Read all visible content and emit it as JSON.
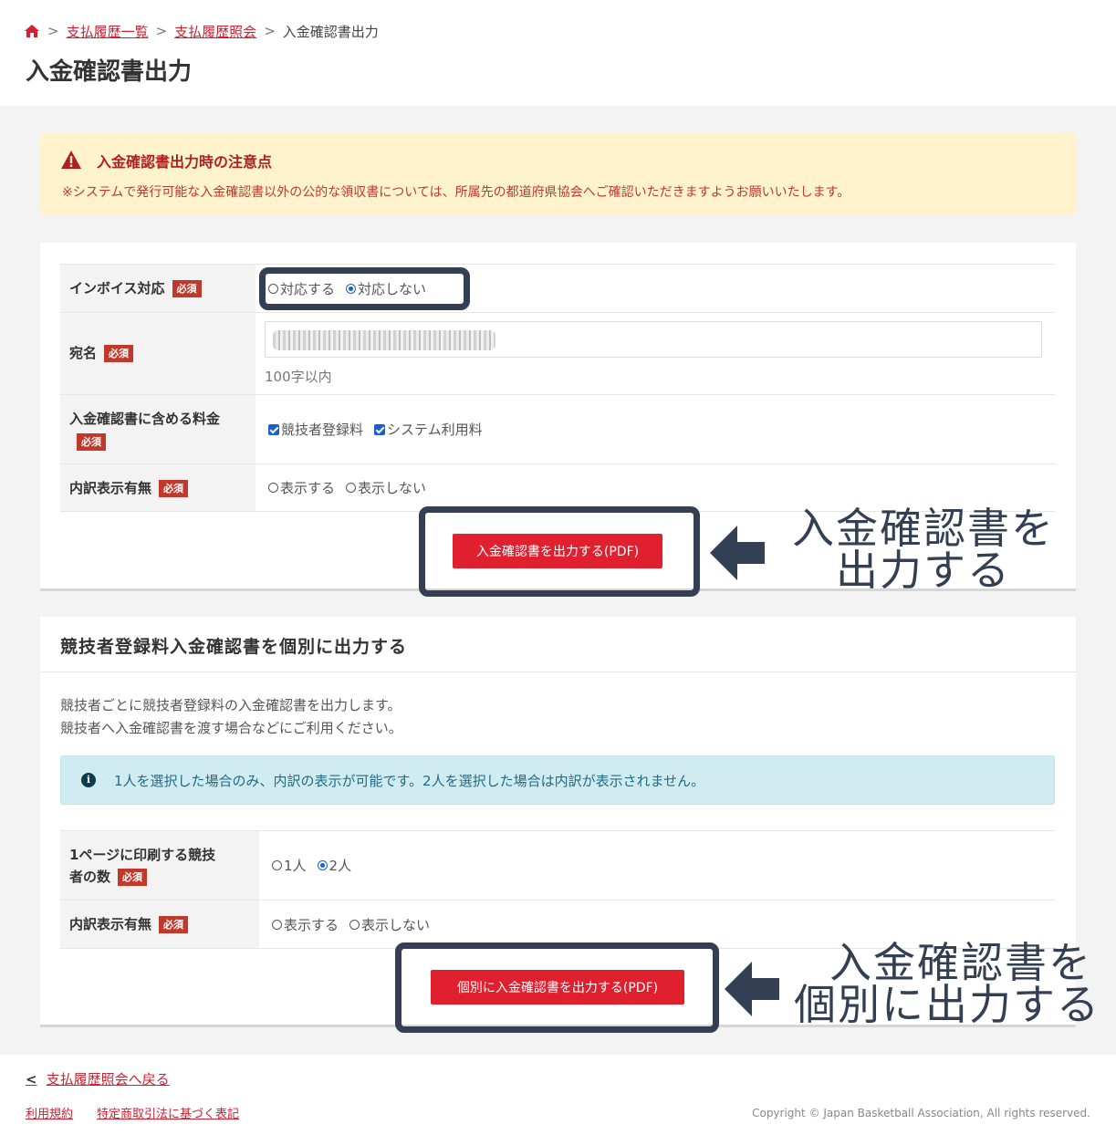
{
  "breadcrumb": {
    "home_icon": "home-icon",
    "items": [
      "支払履歴一覧",
      "支払履歴照会"
    ],
    "current": "入金確認書出力",
    "separator": ">"
  },
  "page_title": "入金確認書出力",
  "alert": {
    "icon": "warning-icon",
    "title": "入金確認書出力時の注意点",
    "text": "※システムで発行可能な入金確認書以外の公的な領収書については、所属先の都道府県協会へご確認いただきますようお願いいたします。"
  },
  "required_badge": "必須",
  "form1": {
    "invoice": {
      "label": "インボイス対応",
      "options": [
        "対応する",
        "対応しない"
      ],
      "selected": "対応しない"
    },
    "addressee": {
      "label": "宛名",
      "value": "",
      "hint": "100字以内"
    },
    "fees": {
      "label": "入金確認書に含める料金",
      "options": [
        "競技者登録料",
        "システム利用料"
      ],
      "checked": [
        "競技者登録料",
        "システム利用料"
      ]
    },
    "breakdown": {
      "label": "内訳表示有無",
      "options": [
        "表示する",
        "表示しない"
      ]
    },
    "submit_label": "入金確認書を出力する(PDF)"
  },
  "annotation1": [
    "入金確認書を",
    "出力する"
  ],
  "section2": {
    "title": "競技者登録料入金確認書を個別に出力する",
    "desc": [
      "競技者ごとに競技者登録料の入金確認書を出力します。",
      "競技者へ入金確認書を渡す場合などにご利用ください。"
    ],
    "info_icon": "info-icon",
    "info": "1人を選択した場合のみ、内訳の表示が可能です。2人を選択した場合は内訳が表示されません。",
    "per_page": {
      "label_lines": [
        "1ページに印刷する競技",
        "者の数"
      ],
      "options": [
        "1人",
        "2人"
      ],
      "selected": "2人"
    },
    "breakdown": {
      "label": "内訳表示有無",
      "options": [
        "表示する",
        "表示しない"
      ]
    },
    "submit_label": "個別に入金確認書を出力する(PDF)"
  },
  "annotation2": [
    "入金確認書を",
    "個別に出力する"
  ],
  "footer": {
    "back_label": "支払履歴照会へ戻る",
    "links": [
      "利用規約",
      "特定商取引法に基づく表記"
    ],
    "copyright": "Copyright © Japan Basketball Association, All rights reserved."
  },
  "colors": {
    "accent": "#e0202e",
    "badge": "#c0392b",
    "annotation": "#333f52",
    "alert_bg": "#fff3cd",
    "info_bg": "#d1ecf1"
  }
}
